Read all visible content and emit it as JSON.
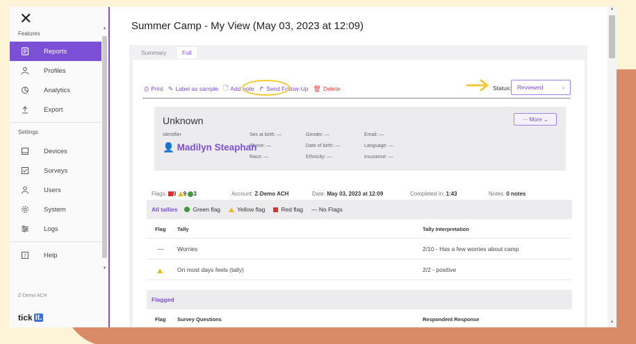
{
  "sidebar": {
    "close_glyph": "✕",
    "features_label": "Features",
    "settings_label": "Settings",
    "features": [
      {
        "label": "Reports",
        "icon": "report-icon",
        "active": true
      },
      {
        "label": "Profiles",
        "icon": "person-icon"
      },
      {
        "label": "Analytics",
        "icon": "chart-icon"
      },
      {
        "label": "Export",
        "icon": "upload-icon"
      }
    ],
    "settings": [
      {
        "label": "Devices",
        "icon": "tablet-icon"
      },
      {
        "label": "Surveys",
        "icon": "checkbox-icon"
      },
      {
        "label": "Users",
        "icon": "person-icon"
      },
      {
        "label": "System",
        "icon": "gear-icon"
      },
      {
        "label": "Logs",
        "icon": "sliders-icon"
      }
    ],
    "help": {
      "label": "Help",
      "icon": "question-icon"
    },
    "org": "Z-Demo ACH",
    "logo": {
      "text": "tick",
      "box": "it."
    }
  },
  "page": {
    "title": "Summer Camp - My View (May 03, 2023 at 12:09)",
    "tabs": [
      {
        "label": "Summary"
      },
      {
        "label": "Full",
        "active": true
      }
    ]
  },
  "toolbar": {
    "print": "Print",
    "label_sample": "Label as sample",
    "add_note": "Add note",
    "send_followup": "Send Follow-Up",
    "delete": "Delete",
    "status_label": "Status:",
    "status_value": "Reviewed"
  },
  "person": {
    "name": "Unknown",
    "more": "··· More",
    "identifier_label": "Identifier",
    "identifier": "Madilyn Steaphan",
    "sex": "Sex at birth: —",
    "phone": "Phone: —",
    "race": "Race: —",
    "gender": "Gender: —",
    "dob": "Date of birth: —",
    "ethnicity": "Ethnicity: —",
    "email": "Email: —",
    "language": "Language: —",
    "insurance": "Insurance: —"
  },
  "meta": {
    "flags_label": "Flags:",
    "red_count": "0",
    "yellow_count": "9",
    "green_count": "3",
    "account_label": "Account:",
    "account": "Z-Demo ACH",
    "date_label": "Date:",
    "date": "May 03, 2023 at 12:09",
    "completed_label": "Completed in:",
    "completed": "1:43",
    "notes_label": "Notes:",
    "notes": "0 notes"
  },
  "legend": {
    "all": "All tallies",
    "green": "Green flag",
    "yellow": "Yellow flag",
    "red": "Red flag",
    "none": "— No Flags"
  },
  "tally_table": {
    "headers": [
      "Flag",
      "Tally",
      "Tally Interpretation"
    ],
    "rows": [
      {
        "flag": "—",
        "tally": "Worries",
        "interp": "2/10 - Has a few worries about camp"
      },
      {
        "flag": "yellow",
        "tally": "On most days feels (tally)",
        "interp": "2/2 - positive"
      }
    ]
  },
  "flagged": {
    "label": "Flagged",
    "headers": [
      "Flag",
      "Survey Questions",
      "Respondent Response"
    ]
  },
  "colors": {
    "accent": "#7b4fd6",
    "highlight": "#f2c833",
    "red": "#d9322c",
    "yellow": "#f2b51d",
    "green": "#3d9b3d"
  }
}
